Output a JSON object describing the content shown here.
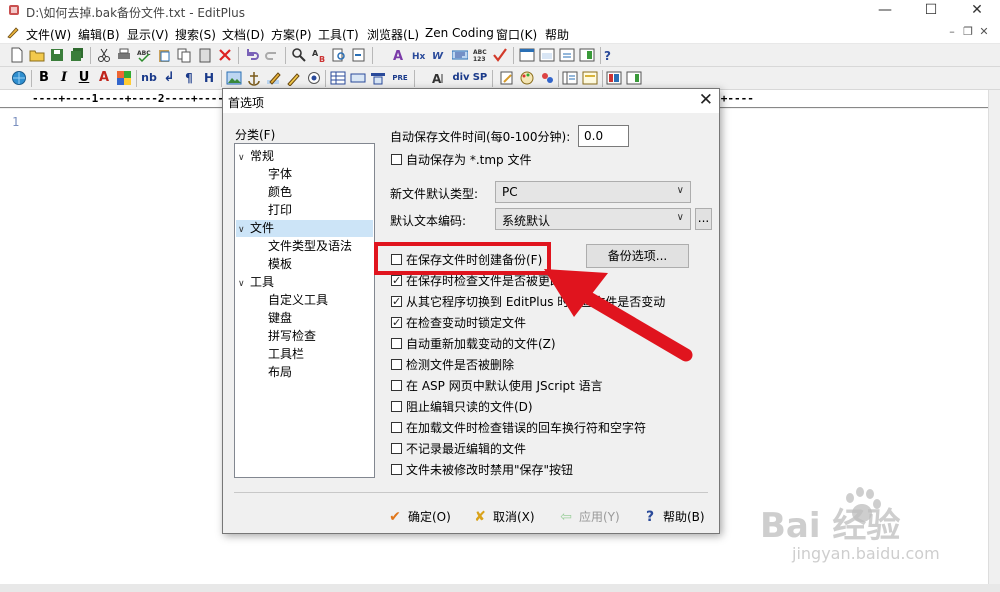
{
  "window": {
    "title": "D:\\如何去掉.bak备份文件.txt - EditPlus",
    "controls": {
      "minimize": "—",
      "maximize": "☐",
      "close": "✕"
    }
  },
  "menu": {
    "items": [
      "文件(W)",
      "编辑(B)",
      "显示(V)",
      "搜索(S)",
      "文档(D)",
      "方案(P)",
      "工具(T)",
      "浏览器(L)",
      "Zen Coding",
      "窗口(K)",
      "帮助"
    ],
    "mdi_controls": {
      "minimize": "–",
      "restore": "❐",
      "close": "✕"
    }
  },
  "toolbar1": {
    "icons": [
      "new-file-icon",
      "open-file-icon",
      "save-icon",
      "save-all-icon",
      "cut-icon",
      "print-icon",
      "spellcheck-icon",
      "paste-icon",
      "copy-icon",
      "delete-icon",
      "undo-icon",
      "redo-icon",
      "find-icon",
      "replace-icon",
      "find-in-files-icon",
      "goto-icon",
      "font-icon",
      "hex-icon",
      "word-wrap-icon",
      "ruler-icon",
      "column-icon",
      "check-icon",
      "window-icon",
      "window2-icon",
      "window3-icon",
      "window4-icon",
      "help-icon"
    ]
  },
  "toolbar2": {
    "labels": {
      "bold": "B",
      "italic": "I",
      "underline": "U",
      "font_color": "A",
      "nbsp": "nb",
      "br": "↲",
      "para": "¶",
      "hr": "H",
      "pre": "PRE",
      "div": "div",
      "span": "SP"
    },
    "icons": [
      "browser-icon",
      "table-icon",
      "image-icon",
      "anchor-icon",
      "color-icon"
    ]
  },
  "ruler": {
    "text": "----+----1----+----2----+----3----+----4----+----5----+----6----+----7----+----8----+----9----+----0----+----"
  },
  "editor": {
    "line_number": "1"
  },
  "dialog": {
    "title": "首选项",
    "close": "✕",
    "category_label": "分类(F)",
    "tree": [
      {
        "label": "常规",
        "level": 0,
        "expanded": true,
        "selected": false
      },
      {
        "label": "字体",
        "level": 1,
        "selected": false
      },
      {
        "label": "颜色",
        "level": 1,
        "selected": false
      },
      {
        "label": "打印",
        "level": 1,
        "selected": false
      },
      {
        "label": "文件",
        "level": 0,
        "expanded": true,
        "selected": true
      },
      {
        "label": "文件类型及语法",
        "level": 1,
        "selected": false
      },
      {
        "label": "模板",
        "level": 1,
        "selected": false
      },
      {
        "label": "工具",
        "level": 0,
        "expanded": true,
        "selected": false
      },
      {
        "label": "自定义工具",
        "level": 1,
        "selected": false
      },
      {
        "label": "键盘",
        "level": 1,
        "selected": false
      },
      {
        "label": "拼写检查",
        "level": 1,
        "selected": false
      },
      {
        "label": "工具栏",
        "level": 1,
        "selected": false
      },
      {
        "label": "布局",
        "level": 1,
        "selected": false
      }
    ],
    "autosave_label": "自动保存文件时间(每0-100分钟):",
    "autosave_value": "0.0",
    "autosave_tmp": {
      "label": "自动保存为 *.tmp 文件",
      "checked": false
    },
    "new_file_type_label": "新文件默认类型:",
    "new_file_type_value": "PC",
    "encoding_label": "默认文本编码:",
    "encoding_value": "系统默认",
    "encoding_more": "...",
    "backup": {
      "label": "在保存文件时创建备份(F)",
      "checked": false
    },
    "backup_options_button": "备份选项...",
    "options": [
      {
        "label": "在保存时检查文件是否被更改",
        "checked": true
      },
      {
        "label": "从其它程序切换到 EditPlus 时检查文件是否变动",
        "checked": true
      },
      {
        "label": "在检查变动时锁定文件",
        "checked": true
      },
      {
        "label": "自动重新加载变动的文件(Z)",
        "checked": false
      },
      {
        "label": "检测文件是否被删除",
        "checked": false
      },
      {
        "label": "在 ASP 网页中默认使用 JScript 语言",
        "checked": false
      },
      {
        "label": "阻止编辑只读的文件(D)",
        "checked": false
      },
      {
        "label": "在加载文件时检查错误的回车换行符和空字符",
        "checked": false
      },
      {
        "label": "不记录最近编辑的文件",
        "checked": false
      },
      {
        "label": "文件未被修改时禁用\"保存\"按钮",
        "checked": false
      }
    ],
    "buttons": {
      "ok": {
        "label": "确定(O)",
        "icon": "✔"
      },
      "cancel": {
        "label": "取消(X)",
        "icon": "✘"
      },
      "apply": {
        "label": "应用(Y)",
        "icon": "⇦"
      },
      "help": {
        "label": "帮助(B)",
        "icon": "?"
      }
    }
  },
  "annotation": {
    "color": "#e0141e"
  },
  "watermark": {
    "brand": "Bai 经验",
    "url": "jingyan.baidu.com"
  }
}
